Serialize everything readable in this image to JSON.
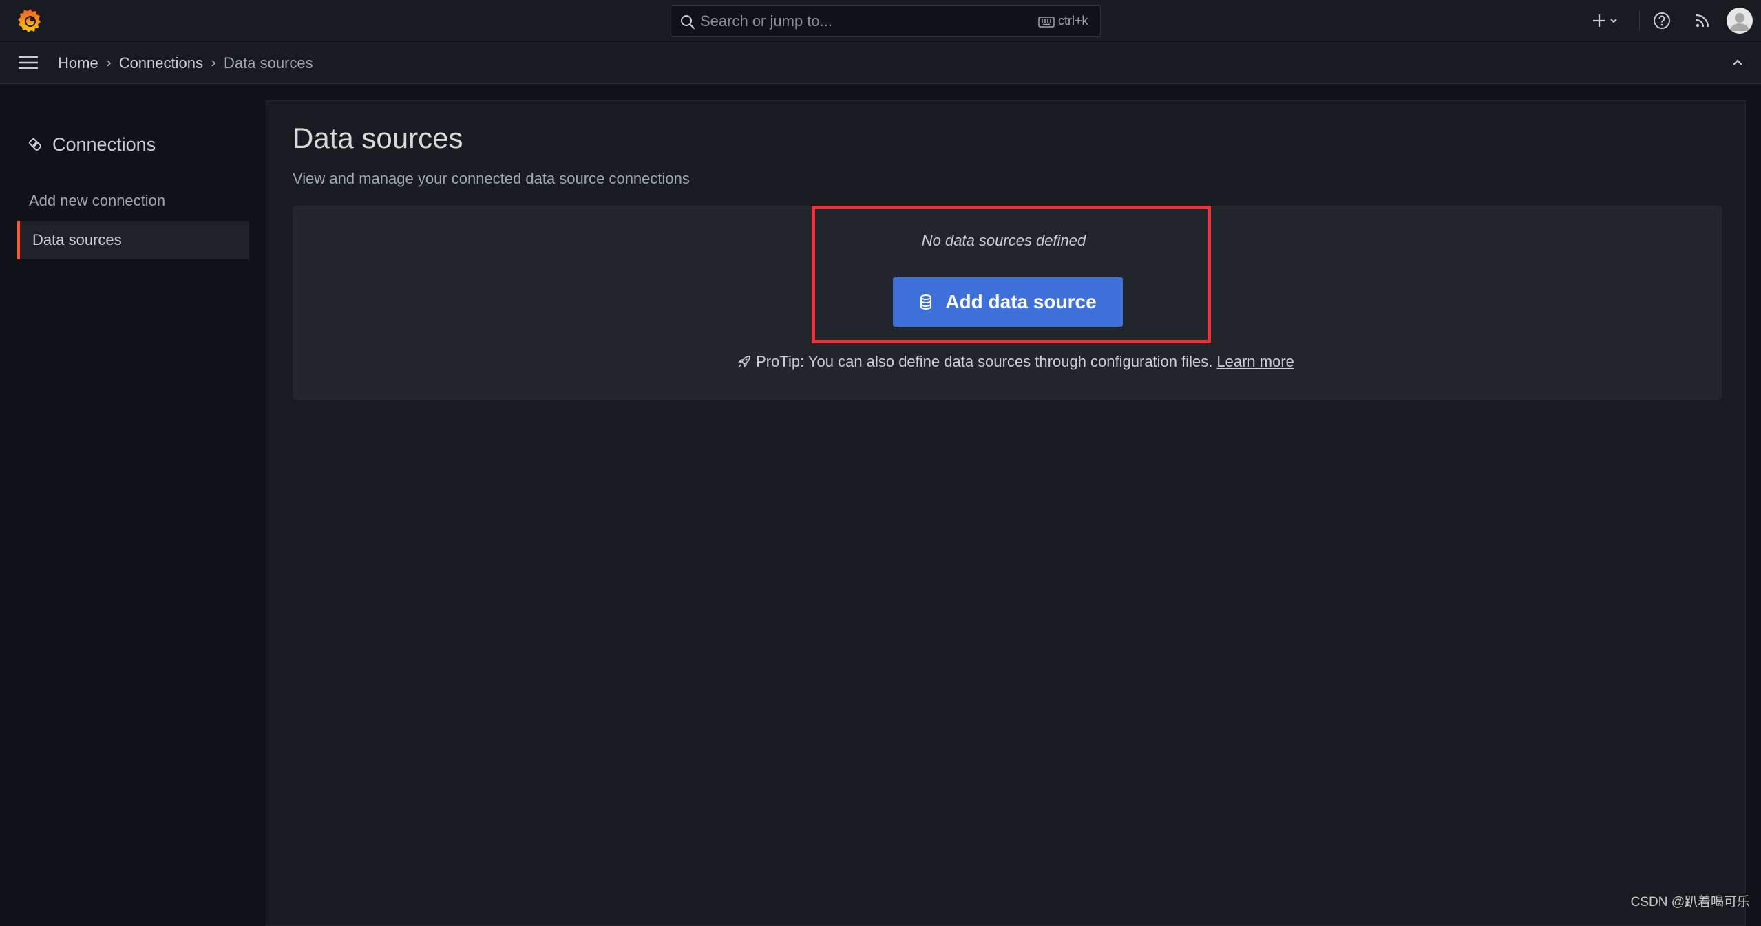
{
  "topbar": {
    "search": {
      "placeholder": "Search or jump to...",
      "shortcut": "ctrl+k"
    }
  },
  "breadcrumb": [
    "Home",
    "Connections",
    "Data sources"
  ],
  "sidenav": {
    "title": "Connections",
    "items": [
      {
        "label": "Add new connection",
        "active": false
      },
      {
        "label": "Data sources",
        "active": true
      }
    ]
  },
  "main": {
    "title": "Data sources",
    "subtitle": "View and manage your connected data source connections",
    "empty": {
      "message": "No data sources defined",
      "button_label": "Add data source",
      "protip": "ProTip: You can also define data sources through configuration files.",
      "protip_link": "Learn more"
    }
  },
  "watermark": "CSDN @趴着喝可乐",
  "colors": {
    "background": "#111217",
    "panel": "#181b1f",
    "primary_button": "#3d71d9",
    "active_accent": "#f55f3e",
    "highlight_box": "#e8333a"
  },
  "icons": [
    "grafana-logo-icon",
    "search-icon",
    "keyboard-icon",
    "plus-icon",
    "chevron-down-icon",
    "help-icon",
    "rss-icon",
    "user-avatar-icon",
    "hamburger-menu-icon",
    "chevron-right-icon",
    "chevron-up-icon",
    "connections-icon",
    "database-icon",
    "rocket-icon"
  ]
}
